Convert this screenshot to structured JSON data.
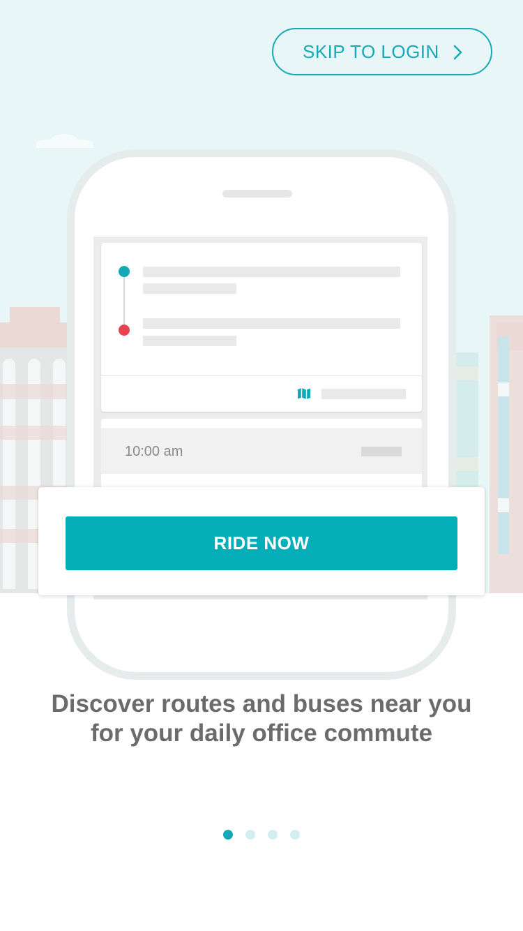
{
  "skip_button": {
    "label": "SKIP TO LOGIN",
    "icon": "chevron-right-icon"
  },
  "illustration": {
    "time_label": "10:00 am",
    "origin_dot_color": "#14aab5",
    "destination_dot_color": "#e8424f",
    "map_icon": "map-icon"
  },
  "cta": {
    "label": "RIDE NOW"
  },
  "tagline": "Discover routes and buses near you for your daily office commute",
  "pagination": {
    "total": 4,
    "active_index": 0
  },
  "colors": {
    "accent": "#03aeb8",
    "hero_background": "#e8f6f7",
    "tagline_text": "#6b6b6b"
  }
}
